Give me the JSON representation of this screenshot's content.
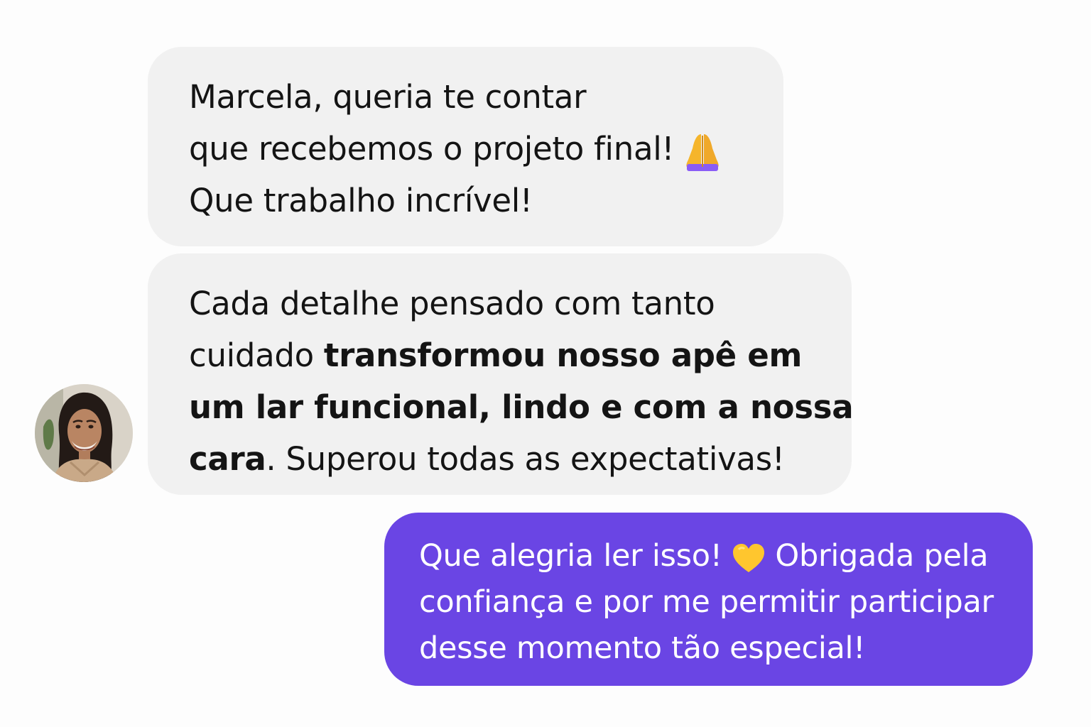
{
  "conversation": {
    "avatar_alt": "",
    "messages": [
      {
        "direction": "incoming",
        "line1": "Marcela, queria te contar",
        "line2_text": "que recebemos o projeto final!",
        "line2_icon": "folded-hands-emoji",
        "line3": "Que trabalho incrível!"
      },
      {
        "direction": "incoming",
        "line1": "Cada detalhe pensado com tanto",
        "line2_normal": "cuidado ",
        "line2_bold": "transformou nosso apê em",
        "line3_bold": "um lar funcional, lindo e com a nossa",
        "line4_bold": "cara",
        "line4_normal": ". Superou todas as expectativas!"
      },
      {
        "direction": "outgoing",
        "line1_before": "Que alegria ler isso!",
        "line1_icon": "yellow-heart-emoji",
        "line1_after": "Obrigada pela",
        "line2": "confiança e por me permitir participar",
        "line3": "desse momento tão especial!"
      }
    ]
  },
  "colors": {
    "background": "#fdfdfd",
    "incoming_bubble": "#f1f1f1",
    "outgoing_bubble": "#6a45e4",
    "incoming_text": "#141414",
    "outgoing_text": "#ffffff"
  }
}
